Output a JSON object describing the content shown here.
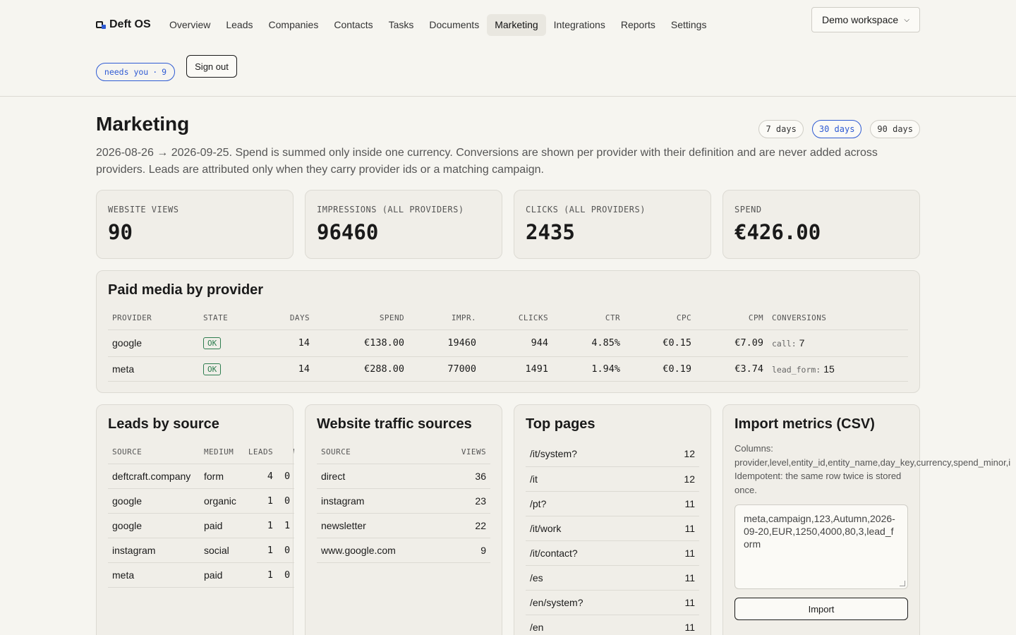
{
  "brand": {
    "name": "Deft OS"
  },
  "nav": {
    "items": [
      {
        "label": "Overview"
      },
      {
        "label": "Leads"
      },
      {
        "label": "Companies"
      },
      {
        "label": "Contacts"
      },
      {
        "label": "Tasks"
      },
      {
        "label": "Documents"
      },
      {
        "label": "Marketing",
        "active": true
      },
      {
        "label": "Integrations"
      },
      {
        "label": "Reports"
      },
      {
        "label": "Settings"
      }
    ]
  },
  "workspace": {
    "selected": "Demo workspace"
  },
  "needs_you": {
    "label": "needs you",
    "sep": "·",
    "count": "9"
  },
  "sign_out": "Sign out",
  "page": {
    "title": "Marketing",
    "subtitle": "2026-08-26 → 2026-09-25. Spend is summed only inside one currency. Conversions are shown per provider with their definition and are never added across providers. Leads are attributed only when they carry provider ids or a matching campaign.",
    "ranges": [
      {
        "label": "7 days"
      },
      {
        "label": "30 days",
        "active": true
      },
      {
        "label": "90 days"
      }
    ]
  },
  "stats": [
    {
      "label": "WEBSITE VIEWS",
      "value": "90"
    },
    {
      "label": "IMPRESSIONS (ALL PROVIDERS)",
      "value": "96460"
    },
    {
      "label": "CLICKS (ALL PROVIDERS)",
      "value": "2435"
    },
    {
      "label": "SPEND",
      "value": "€426.00"
    }
  ],
  "paid_media": {
    "title": "Paid media by provider",
    "columns": [
      "PROVIDER",
      "STATE",
      "DAYS",
      "SPEND",
      "IMPR.",
      "CLICKS",
      "CTR",
      "CPC",
      "CPM",
      "CONVERSIONS"
    ],
    "rows": [
      {
        "provider": "google",
        "state": "OK",
        "days": "14",
        "spend": "€138.00",
        "impr": "19460",
        "clicks": "944",
        "ctr": "4.85%",
        "cpc": "€0.15",
        "cpm": "€7.09",
        "conv_key": "call:",
        "conv_val": "7"
      },
      {
        "provider": "meta",
        "state": "OK",
        "days": "14",
        "spend": "€288.00",
        "impr": "77000",
        "clicks": "1491",
        "ctr": "1.94%",
        "cpc": "€0.19",
        "cpm": "€3.74",
        "conv_key": "lead_form:",
        "conv_val": "15"
      }
    ]
  },
  "leads_by_source": {
    "title": "Leads by source",
    "columns": [
      "SOURCE",
      "MEDIUM",
      "LEADS",
      "WON"
    ],
    "rows": [
      {
        "source": "deftcraft.company",
        "medium": "form",
        "leads": "4",
        "won": "0"
      },
      {
        "source": "google",
        "medium": "organic",
        "leads": "1",
        "won": "0"
      },
      {
        "source": "google",
        "medium": "paid",
        "leads": "1",
        "won": "1"
      },
      {
        "source": "instagram",
        "medium": "social",
        "leads": "1",
        "won": "0"
      },
      {
        "source": "meta",
        "medium": "paid",
        "leads": "1",
        "won": "0"
      }
    ]
  },
  "traffic_sources": {
    "title": "Website traffic sources",
    "columns": [
      "SOURCE",
      "VIEWS"
    ],
    "rows": [
      {
        "source": "direct",
        "views": "36"
      },
      {
        "source": "instagram",
        "views": "23"
      },
      {
        "source": "newsletter",
        "views": "22"
      },
      {
        "source": "www.google.com",
        "views": "9"
      }
    ]
  },
  "top_pages": {
    "title": "Top pages",
    "rows": [
      {
        "path": "/it/system?",
        "views": "12"
      },
      {
        "path": "/it",
        "views": "12"
      },
      {
        "path": "/pt?",
        "views": "11"
      },
      {
        "path": "/it/work",
        "views": "11"
      },
      {
        "path": "/it/contact?",
        "views": "11"
      },
      {
        "path": "/es",
        "views": "11"
      },
      {
        "path": "/en/system?",
        "views": "11"
      },
      {
        "path": "/en",
        "views": "11"
      }
    ]
  },
  "import_csv": {
    "title": "Import metrics (CSV)",
    "columns_line1": "Columns:",
    "columns_line2": "provider,level,entity_id,entity_name,day_key,currency,spend_minor,i",
    "idempotent": "Idempotent: the same row twice is stored once.",
    "textarea_value": "meta,campaign,123,Autumn,2026-09-20,EUR,1250,4000,80,3,lead_form",
    "button": "Import"
  }
}
